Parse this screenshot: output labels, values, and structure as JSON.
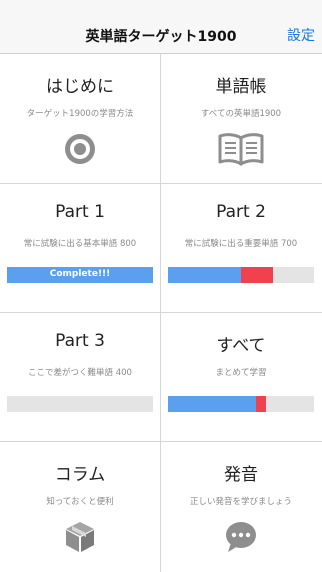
{
  "navbar": {
    "title": "英単語ターゲット1900",
    "settings_label": "設定"
  },
  "colors": {
    "progress_blue": "#5aa0ef",
    "progress_red": "#f0414f",
    "progress_track": "#e4e4e4",
    "accent": "#1a74e8",
    "icon_gray": "#8e8e8e"
  },
  "menu": {
    "intro": {
      "title": "はじめに",
      "subtitle": "ターゲット1900の学習方法",
      "icon": "target-icon"
    },
    "wordbook": {
      "title": "単語帳",
      "subtitle": "すべての英単語1900",
      "icon": "book-icon"
    },
    "part1": {
      "title": "Part 1",
      "subtitle": "常に試験に出る基本単語 800",
      "progress_label": "Complete!!!",
      "progress_mastered": 1.0,
      "progress_review": 0.0
    },
    "part2": {
      "title": "Part 2",
      "subtitle": "常に試験に出る重要単語 700",
      "progress_mastered": 0.5,
      "progress_review": 0.22
    },
    "part3": {
      "title": "Part 3",
      "subtitle": "ここで差がつく難単語 400",
      "progress_mastered": 0.0,
      "progress_review": 0.0
    },
    "all": {
      "title": "すべて",
      "subtitle": "まとめて学習",
      "progress_mastered": 0.6,
      "progress_review": 0.07
    },
    "column": {
      "title": "コラム",
      "subtitle": "知っておくと便利",
      "icon": "box-icon"
    },
    "pronunciation": {
      "title": "発音",
      "subtitle": "正しい発音を学びましょう",
      "icon": "speech-bubble-icon"
    }
  }
}
